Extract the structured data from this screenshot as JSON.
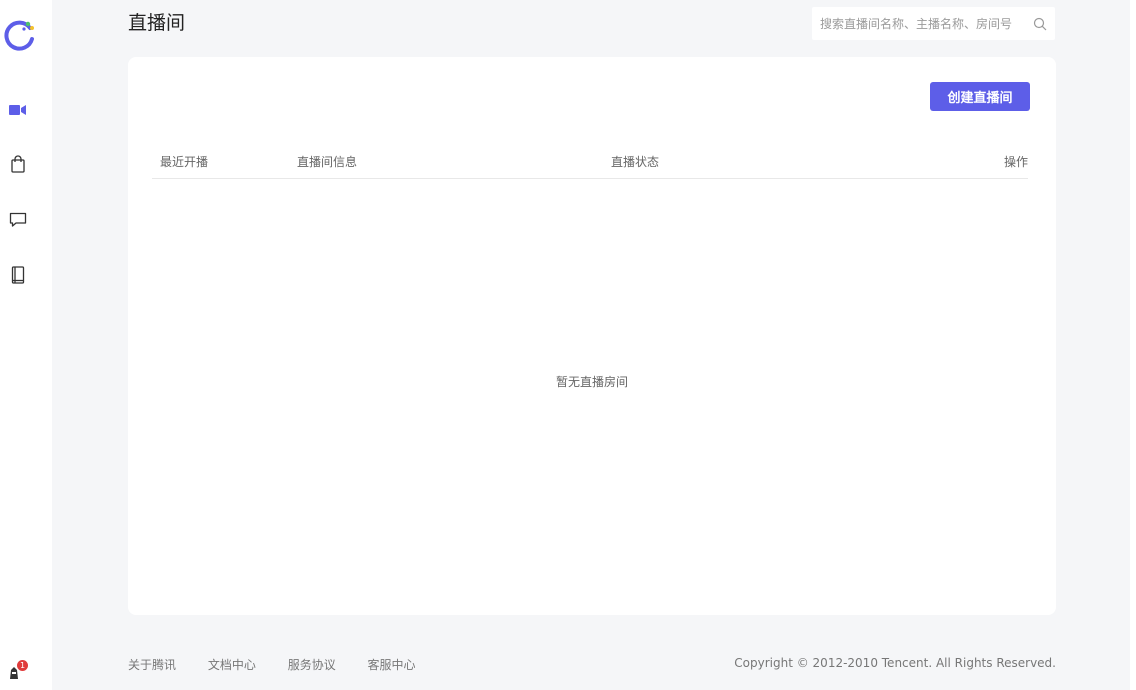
{
  "header": {
    "title": "直播间",
    "search_placeholder": "搜索直播间名称、主播名称、房间号"
  },
  "sidebar": {
    "items": [
      {
        "icon": "video-camera-icon",
        "active": true
      },
      {
        "icon": "shopping-bag-icon",
        "active": false
      },
      {
        "icon": "chat-bubble-icon",
        "active": false
      },
      {
        "icon": "book-icon",
        "active": false
      }
    ],
    "notification_count": "1"
  },
  "main": {
    "create_button_label": "创建直播间",
    "table": {
      "columns": [
        "最近开播",
        "直播间信息",
        "直播状态",
        "操作"
      ]
    },
    "empty_text": "暂无直播房间"
  },
  "footer": {
    "links": [
      "关于腾讯",
      "文档中心",
      "服务协议",
      "客服中心"
    ],
    "copyright": "Copyright © 2012-2010 Tencent. All Rights Reserved."
  },
  "colors": {
    "accent": "#5d5ee8",
    "background": "#f5f6f8"
  }
}
